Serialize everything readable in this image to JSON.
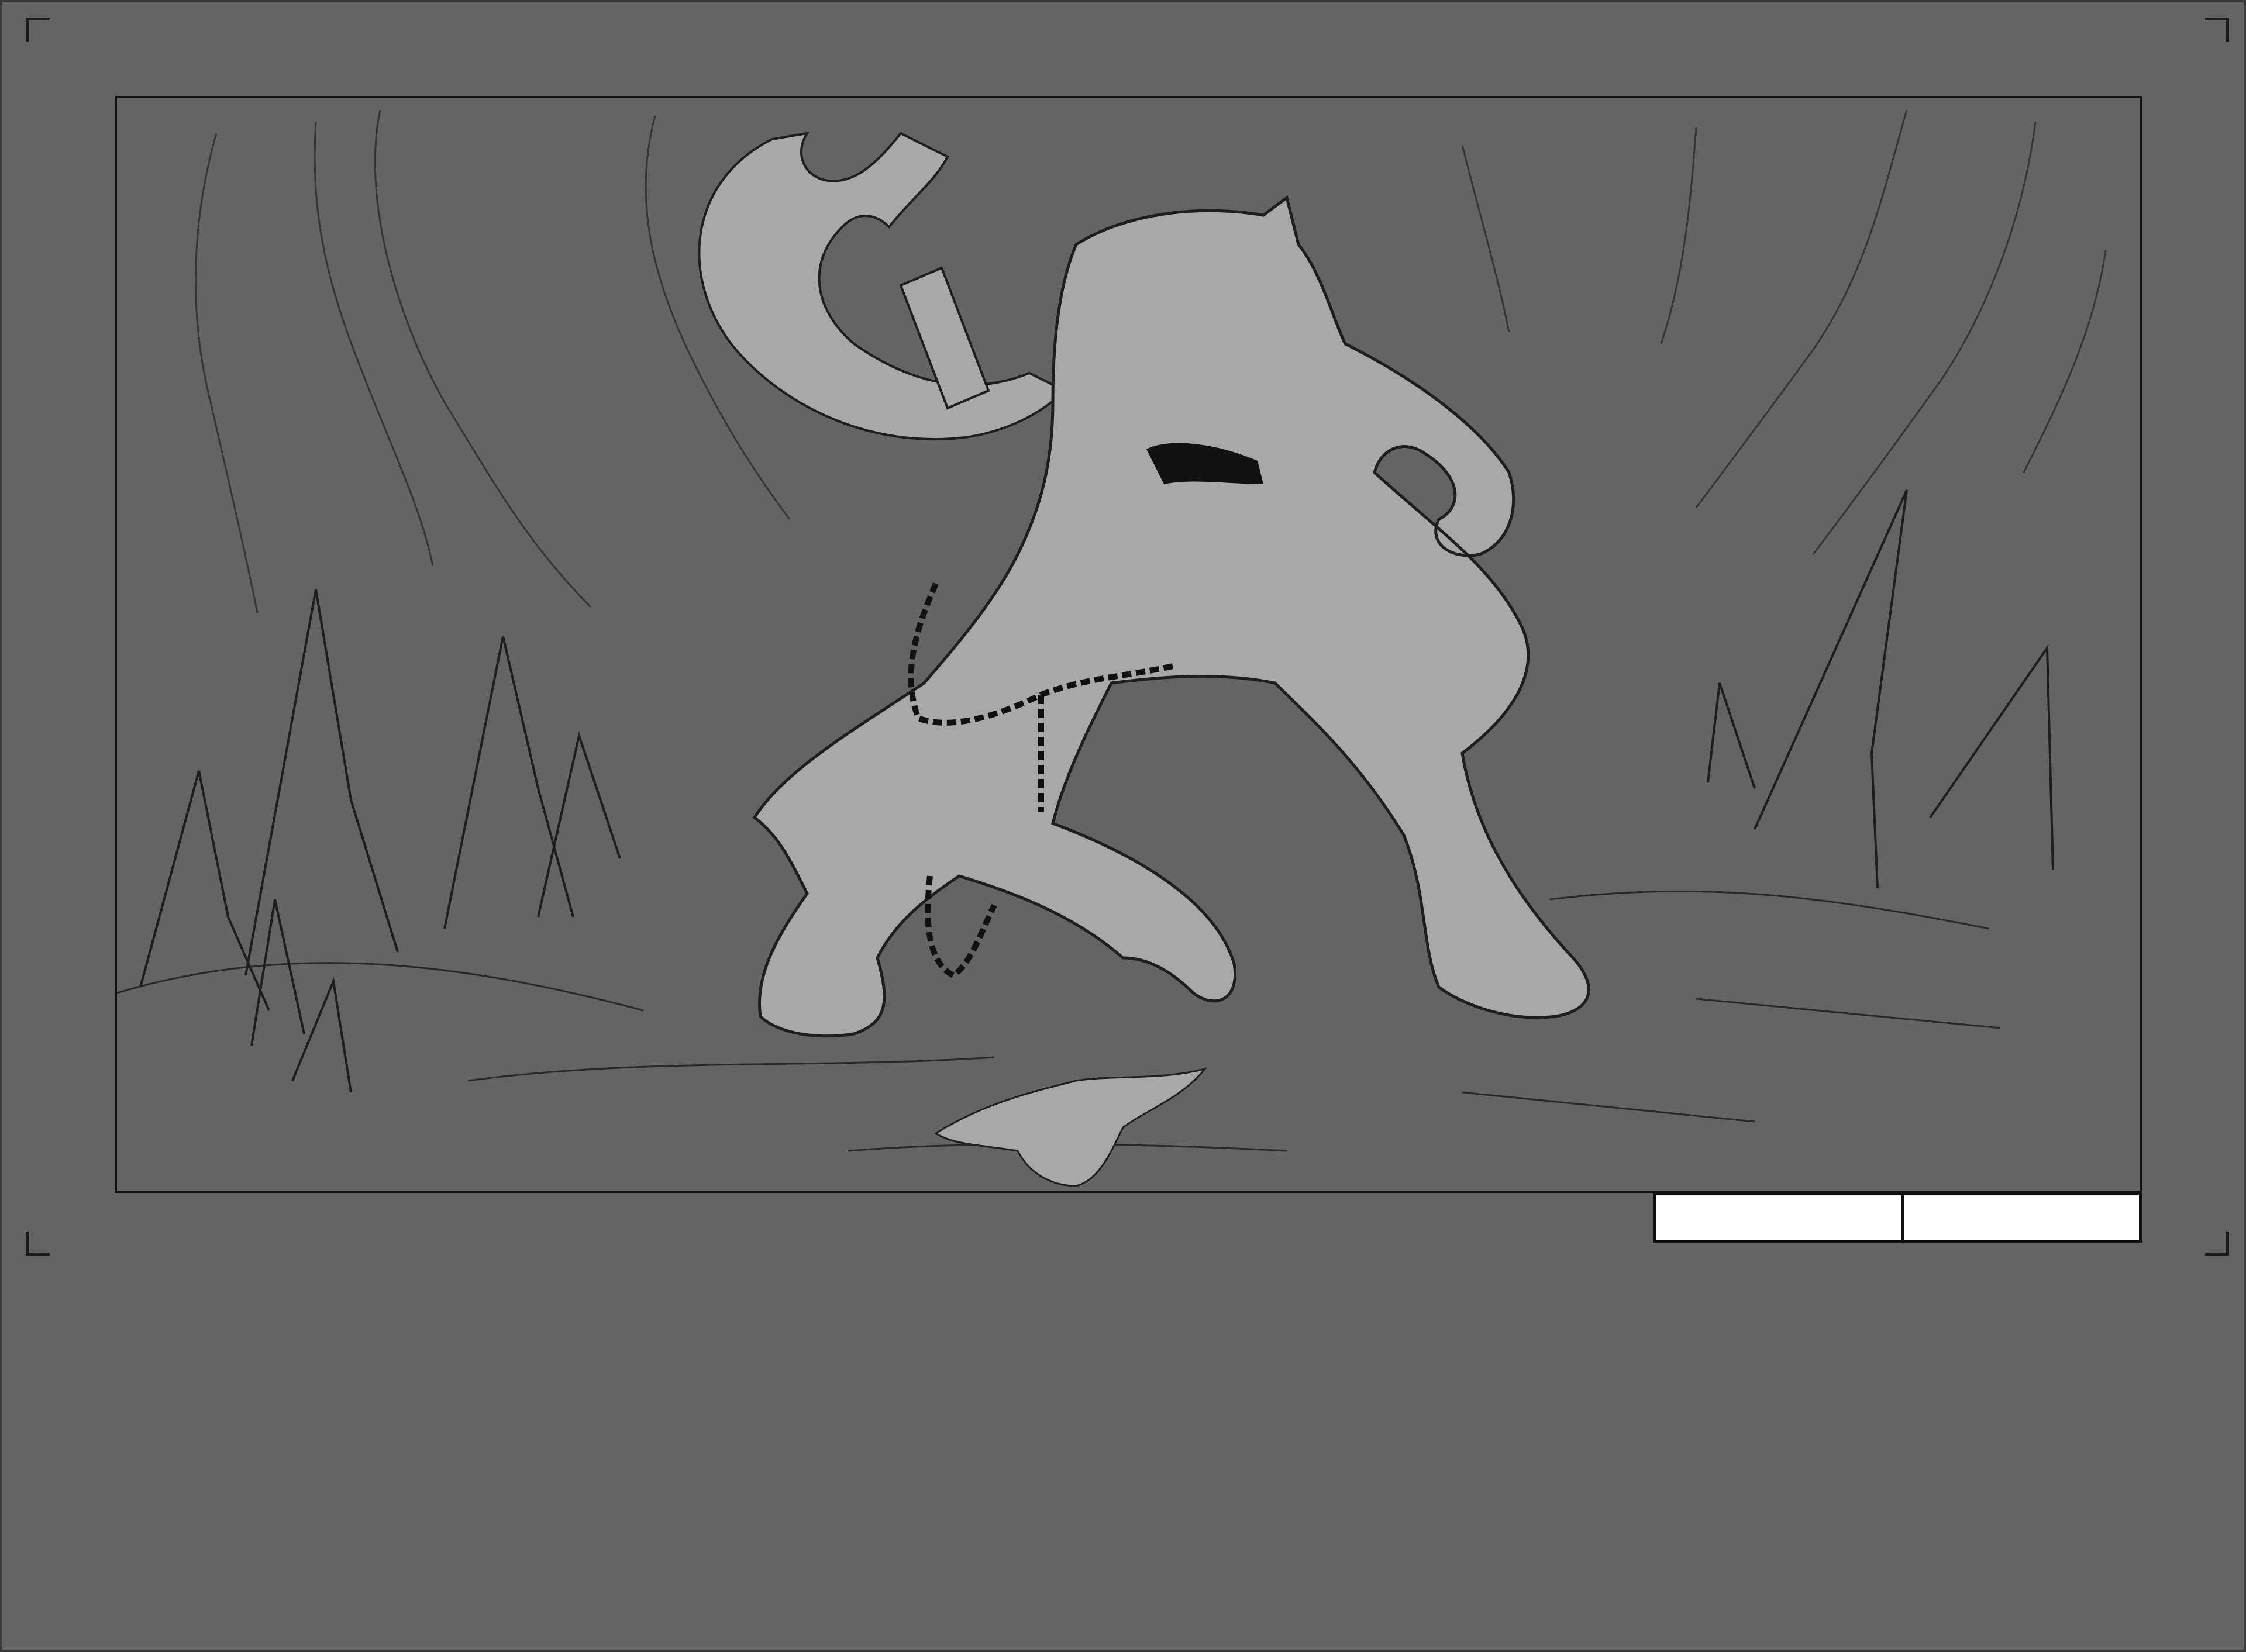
{
  "page": {
    "background_color": "#626262",
    "frame_border_color": "#111111"
  },
  "sheet": {
    "crop_marks": [
      "top-left",
      "top-right",
      "bottom-left",
      "bottom-right"
    ]
  },
  "panel": {
    "description_icon": "storyboard-sketch-icon",
    "figure_fill": "#a8a8a8",
    "line_color": "#1e1e1e"
  },
  "fields": {
    "scene_value": "",
    "shot_value": ""
  }
}
